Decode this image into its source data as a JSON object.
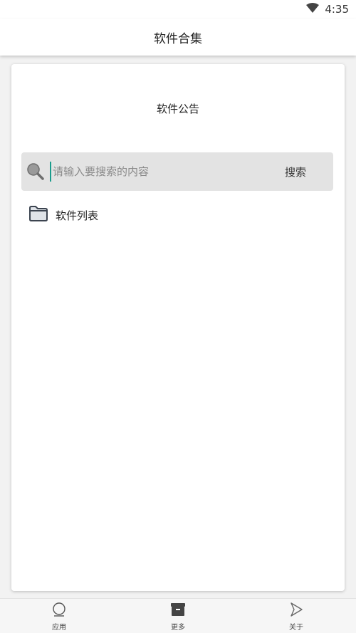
{
  "status_bar": {
    "time": "4:35",
    "icons": [
      "wifi-icon"
    ]
  },
  "app_bar": {
    "title": "软件合集"
  },
  "card": {
    "notice_title": "软件公告",
    "search": {
      "placeholder": "请输入要搜索的内容",
      "value": "",
      "button_label": "搜索",
      "icon": "search-icon"
    },
    "items": [
      {
        "label": "软件列表",
        "icon": "folder-icon"
      }
    ]
  },
  "bottom_nav": {
    "items": [
      {
        "label": "应用",
        "icon": "circle-icon"
      },
      {
        "label": "更多",
        "icon": "archive-icon"
      },
      {
        "label": "关于",
        "icon": "play-outline-icon"
      }
    ]
  },
  "colors": {
    "background": "#f2f2f2",
    "card": "#ffffff",
    "search_bg": "#e3e3e3",
    "cursor_accent": "#1a9c8c"
  }
}
